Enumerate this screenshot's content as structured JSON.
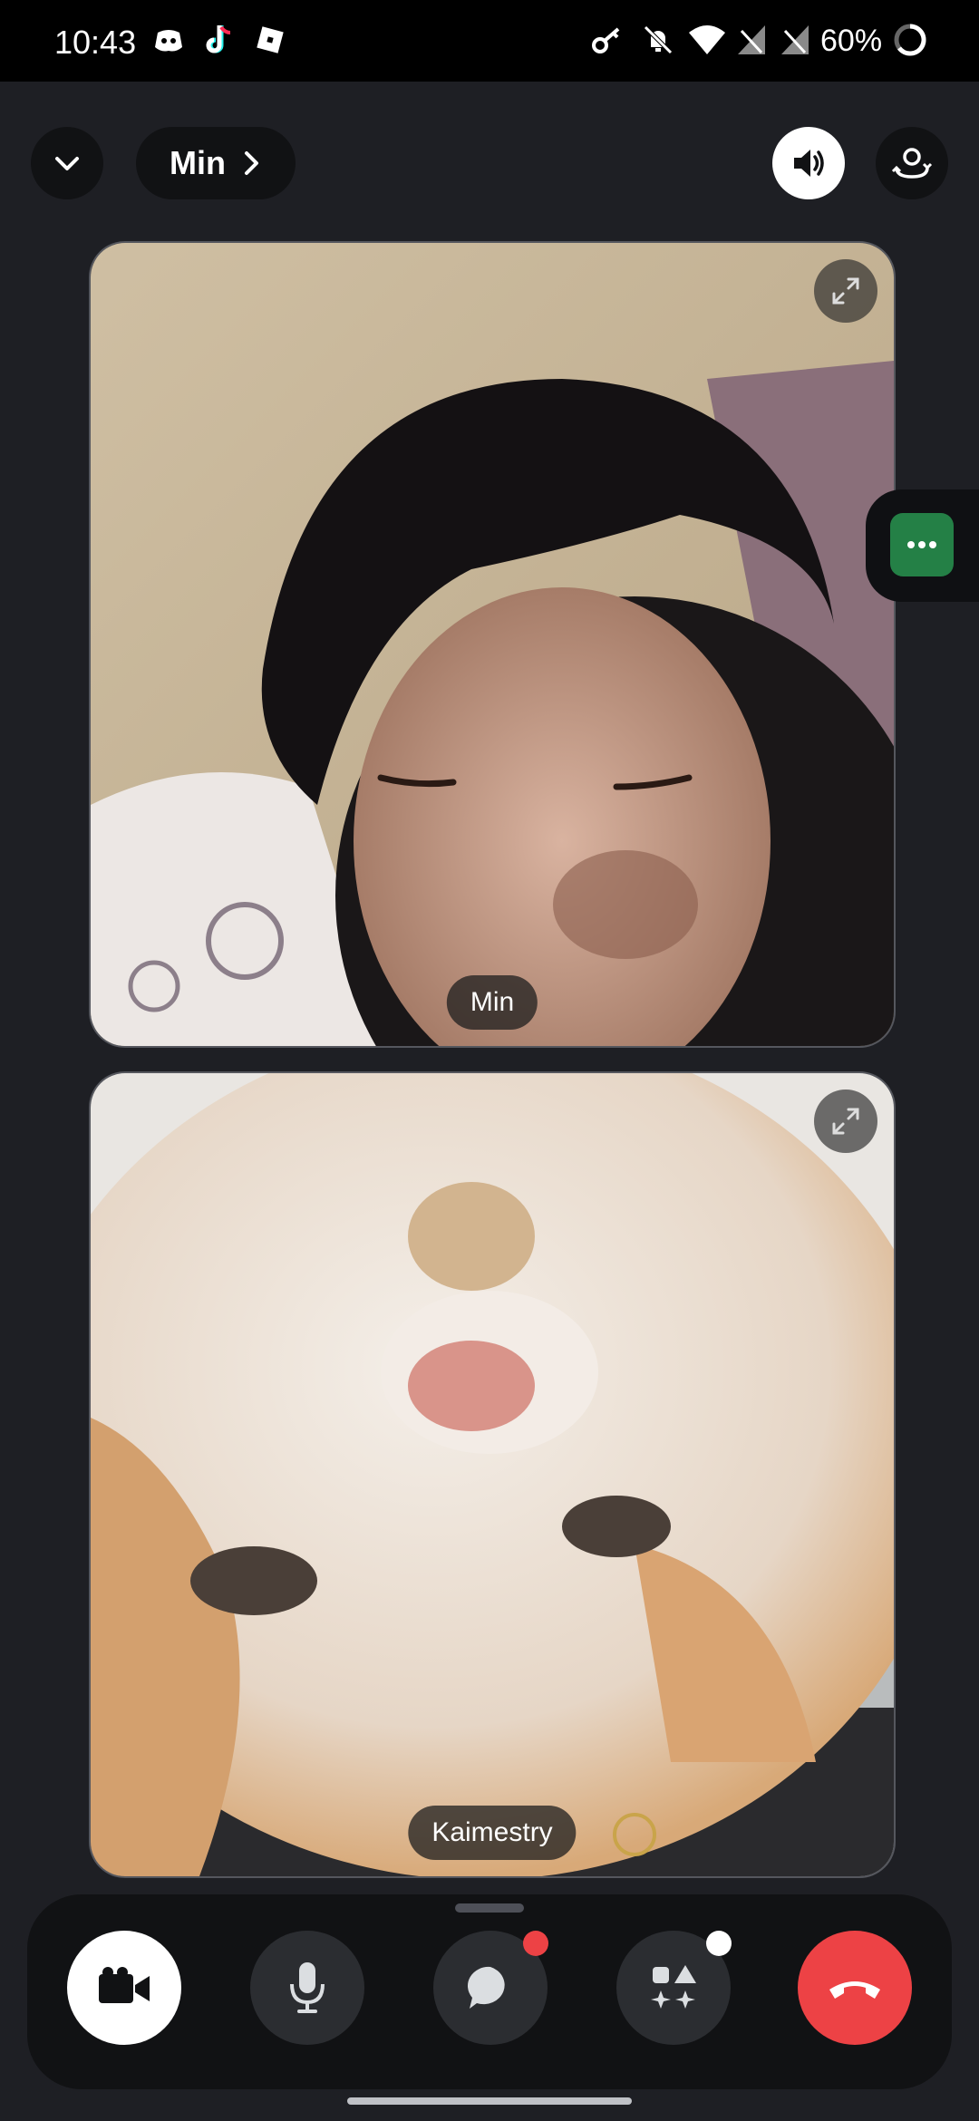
{
  "status_bar": {
    "time": "10:43",
    "app_icons": [
      "discord-icon",
      "tiktok-icon",
      "roblox-icon"
    ],
    "right_icons": [
      "key-icon",
      "bell-off-icon",
      "wifi-icon",
      "no-signal-icon",
      "no-signal-icon"
    ],
    "battery": "60%"
  },
  "top_bar": {
    "collapse_icon": "chevron-down-icon",
    "channel_name": "Min",
    "speaker_icon": "speaker-icon",
    "flip_camera_icon": "camera-flip-icon"
  },
  "tiles": [
    {
      "label": "Min",
      "content": "camera-feed"
    },
    {
      "label": "Kaimestry",
      "content": "camera-feed"
    }
  ],
  "controls": {
    "video": "video-camera-icon",
    "mic": "microphone-icon",
    "chat": "chat-bubble-icon",
    "activities": "activities-icon",
    "hangup": "hang-up-icon"
  },
  "colors": {
    "background": "#1e1f24",
    "hangup": "#ed4245",
    "side_panel_button": "#248046",
    "notification_dot": "#ed4245"
  }
}
